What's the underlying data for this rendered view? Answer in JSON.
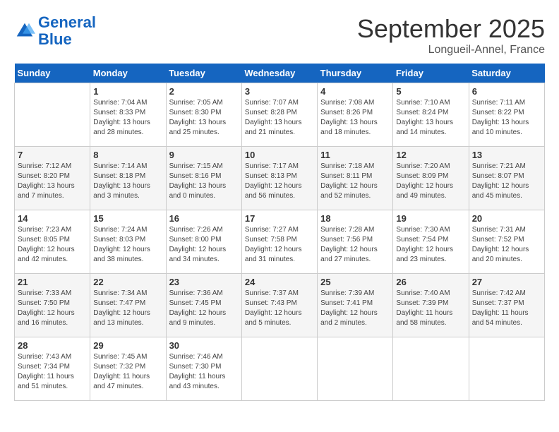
{
  "header": {
    "logo_line1": "General",
    "logo_line2": "Blue",
    "month": "September 2025",
    "location": "Longueil-Annel, France"
  },
  "weekdays": [
    "Sunday",
    "Monday",
    "Tuesday",
    "Wednesday",
    "Thursday",
    "Friday",
    "Saturday"
  ],
  "weeks": [
    [
      {
        "day": "",
        "info": ""
      },
      {
        "day": "1",
        "info": "Sunrise: 7:04 AM\nSunset: 8:33 PM\nDaylight: 13 hours\nand 28 minutes."
      },
      {
        "day": "2",
        "info": "Sunrise: 7:05 AM\nSunset: 8:30 PM\nDaylight: 13 hours\nand 25 minutes."
      },
      {
        "day": "3",
        "info": "Sunrise: 7:07 AM\nSunset: 8:28 PM\nDaylight: 13 hours\nand 21 minutes."
      },
      {
        "day": "4",
        "info": "Sunrise: 7:08 AM\nSunset: 8:26 PM\nDaylight: 13 hours\nand 18 minutes."
      },
      {
        "day": "5",
        "info": "Sunrise: 7:10 AM\nSunset: 8:24 PM\nDaylight: 13 hours\nand 14 minutes."
      },
      {
        "day": "6",
        "info": "Sunrise: 7:11 AM\nSunset: 8:22 PM\nDaylight: 13 hours\nand 10 minutes."
      }
    ],
    [
      {
        "day": "7",
        "info": "Sunrise: 7:12 AM\nSunset: 8:20 PM\nDaylight: 13 hours\nand 7 minutes."
      },
      {
        "day": "8",
        "info": "Sunrise: 7:14 AM\nSunset: 8:18 PM\nDaylight: 13 hours\nand 3 minutes."
      },
      {
        "day": "9",
        "info": "Sunrise: 7:15 AM\nSunset: 8:16 PM\nDaylight: 13 hours\nand 0 minutes."
      },
      {
        "day": "10",
        "info": "Sunrise: 7:17 AM\nSunset: 8:13 PM\nDaylight: 12 hours\nand 56 minutes."
      },
      {
        "day": "11",
        "info": "Sunrise: 7:18 AM\nSunset: 8:11 PM\nDaylight: 12 hours\nand 52 minutes."
      },
      {
        "day": "12",
        "info": "Sunrise: 7:20 AM\nSunset: 8:09 PM\nDaylight: 12 hours\nand 49 minutes."
      },
      {
        "day": "13",
        "info": "Sunrise: 7:21 AM\nSunset: 8:07 PM\nDaylight: 12 hours\nand 45 minutes."
      }
    ],
    [
      {
        "day": "14",
        "info": "Sunrise: 7:23 AM\nSunset: 8:05 PM\nDaylight: 12 hours\nand 42 minutes."
      },
      {
        "day": "15",
        "info": "Sunrise: 7:24 AM\nSunset: 8:03 PM\nDaylight: 12 hours\nand 38 minutes."
      },
      {
        "day": "16",
        "info": "Sunrise: 7:26 AM\nSunset: 8:00 PM\nDaylight: 12 hours\nand 34 minutes."
      },
      {
        "day": "17",
        "info": "Sunrise: 7:27 AM\nSunset: 7:58 PM\nDaylight: 12 hours\nand 31 minutes."
      },
      {
        "day": "18",
        "info": "Sunrise: 7:28 AM\nSunset: 7:56 PM\nDaylight: 12 hours\nand 27 minutes."
      },
      {
        "day": "19",
        "info": "Sunrise: 7:30 AM\nSunset: 7:54 PM\nDaylight: 12 hours\nand 23 minutes."
      },
      {
        "day": "20",
        "info": "Sunrise: 7:31 AM\nSunset: 7:52 PM\nDaylight: 12 hours\nand 20 minutes."
      }
    ],
    [
      {
        "day": "21",
        "info": "Sunrise: 7:33 AM\nSunset: 7:50 PM\nDaylight: 12 hours\nand 16 minutes."
      },
      {
        "day": "22",
        "info": "Sunrise: 7:34 AM\nSunset: 7:47 PM\nDaylight: 12 hours\nand 13 minutes."
      },
      {
        "day": "23",
        "info": "Sunrise: 7:36 AM\nSunset: 7:45 PM\nDaylight: 12 hours\nand 9 minutes."
      },
      {
        "day": "24",
        "info": "Sunrise: 7:37 AM\nSunset: 7:43 PM\nDaylight: 12 hours\nand 5 minutes."
      },
      {
        "day": "25",
        "info": "Sunrise: 7:39 AM\nSunset: 7:41 PM\nDaylight: 12 hours\nand 2 minutes."
      },
      {
        "day": "26",
        "info": "Sunrise: 7:40 AM\nSunset: 7:39 PM\nDaylight: 11 hours\nand 58 minutes."
      },
      {
        "day": "27",
        "info": "Sunrise: 7:42 AM\nSunset: 7:37 PM\nDaylight: 11 hours\nand 54 minutes."
      }
    ],
    [
      {
        "day": "28",
        "info": "Sunrise: 7:43 AM\nSunset: 7:34 PM\nDaylight: 11 hours\nand 51 minutes."
      },
      {
        "day": "29",
        "info": "Sunrise: 7:45 AM\nSunset: 7:32 PM\nDaylight: 11 hours\nand 47 minutes."
      },
      {
        "day": "30",
        "info": "Sunrise: 7:46 AM\nSunset: 7:30 PM\nDaylight: 11 hours\nand 43 minutes."
      },
      {
        "day": "",
        "info": ""
      },
      {
        "day": "",
        "info": ""
      },
      {
        "day": "",
        "info": ""
      },
      {
        "day": "",
        "info": ""
      }
    ]
  ]
}
